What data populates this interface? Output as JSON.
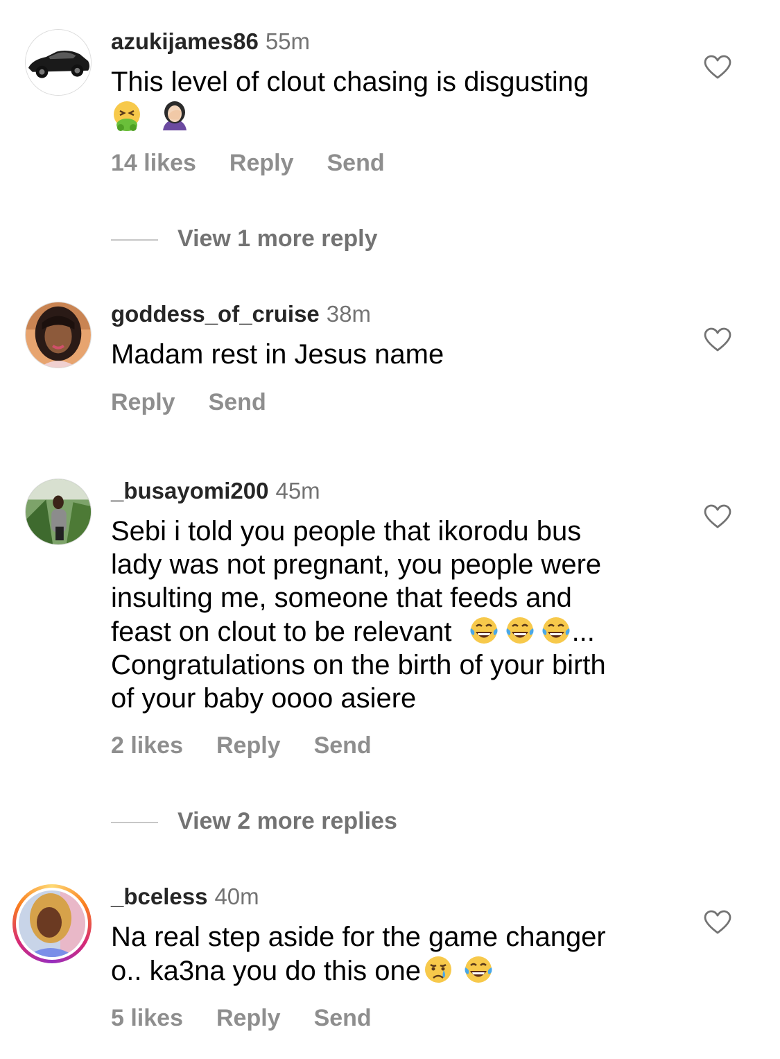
{
  "comments": [
    {
      "username": "azukijames86",
      "time": "55m",
      "text_lines": [
        "This level of clout chasing is disgusting"
      ],
      "emojis": [
        "nauseated-face-emoji",
        "woman-facepalming-emoji"
      ],
      "likes": "14 likes",
      "reply": "Reply",
      "send": "Send",
      "view_more": "View 1 more reply"
    },
    {
      "username": "goddess_of_cruise",
      "time": "38m",
      "text_lines": [
        "Madam rest in Jesus name"
      ],
      "reply": "Reply",
      "send": "Send"
    },
    {
      "username": "_busayomi200",
      "time": "45m",
      "text_lines": [
        "Sebi i told you people that ikorodu bus",
        "lady was not pregnant, you people were",
        "insulting me, someone that feeds and",
        "feast on clout to be relevant",
        "...",
        "Congratulations on the birth of your birth",
        "of your baby oooo asiere"
      ],
      "emojis": [
        "laughing-tears-emoji",
        "laughing-tears-emoji",
        "laughing-tears-emoji"
      ],
      "likes": "2 likes",
      "reply": "Reply",
      "send": "Send",
      "view_more": "View 2 more replies"
    },
    {
      "username": "_bceless",
      "time": "40m",
      "text_lines": [
        "Na real step aside for the game changer",
        "o.. ka3na you do this one"
      ],
      "emojis": [
        "crying-face-emoji",
        "laughing-tears-emoji"
      ],
      "likes": "5 likes",
      "reply": "Reply",
      "send": "Send"
    }
  ],
  "icons": {
    "heart": "heart-outline-icon"
  }
}
